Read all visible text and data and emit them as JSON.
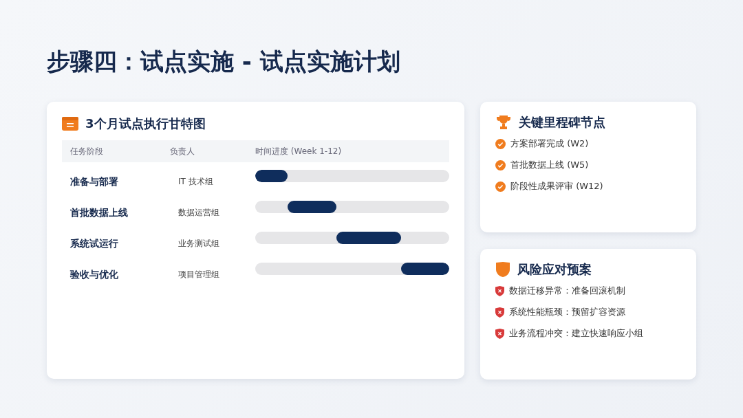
{
  "title": "步骤四：试点实施 - 试点实施计划",
  "gantt": {
    "title": "3个月试点执行甘特图",
    "columns": [
      "任务阶段",
      "负责人",
      "时间进度 (Week 1-12)"
    ],
    "rows": [
      {
        "task": "准备与部署",
        "owner": "IT 技术组",
        "weeks": [
          {
            "on": true
          },
          {
            "on": true
          },
          {
            "on": false
          },
          {
            "on": false
          },
          {
            "on": false
          },
          {
            "on": false
          },
          {
            "on": false
          },
          {
            "on": false
          },
          {
            "on": false
          },
          {
            "on": false
          },
          {
            "on": false
          },
          {
            "on": false
          }
        ]
      },
      {
        "task": "首批数据上线",
        "owner": "数据运营组",
        "weeks": [
          {
            "on": false
          },
          {
            "on": false
          },
          {
            "on": true
          },
          {
            "on": true
          },
          {
            "on": true
          },
          {
            "on": false
          },
          {
            "on": false
          },
          {
            "on": false
          },
          {
            "on": false
          },
          {
            "on": false
          },
          {
            "on": false
          },
          {
            "on": false
          }
        ]
      },
      {
        "task": "系统试运行",
        "owner": "业务测试组",
        "weeks": [
          {
            "on": false
          },
          {
            "on": false
          },
          {
            "on": false
          },
          {
            "on": false
          },
          {
            "on": false
          },
          {
            "on": true
          },
          {
            "on": true
          },
          {
            "on": true
          },
          {
            "on": true
          },
          {
            "on": false
          },
          {
            "on": false
          },
          {
            "on": false
          }
        ]
      },
      {
        "task": "验收与优化",
        "owner": "项目管理组",
        "weeks": [
          {
            "on": false
          },
          {
            "on": false
          },
          {
            "on": false
          },
          {
            "on": false
          },
          {
            "on": false
          },
          {
            "on": false
          },
          {
            "on": false
          },
          {
            "on": false
          },
          {
            "on": false
          },
          {
            "on": true
          },
          {
            "on": true
          },
          {
            "on": true
          }
        ]
      }
    ]
  },
  "milestones": {
    "title": "关键里程碑节点",
    "items": [
      "方案部署完成 (W2)",
      "首批数据上线 (W5)",
      "阶段性成果评审 (W12)"
    ]
  },
  "risks": {
    "title": "风险应对预案",
    "items": [
      "数据迁移异常：准备回滚机制",
      "系统性能瓶颈：预留扩容资源",
      "业务流程冲突：建立快速响应小组"
    ]
  }
}
